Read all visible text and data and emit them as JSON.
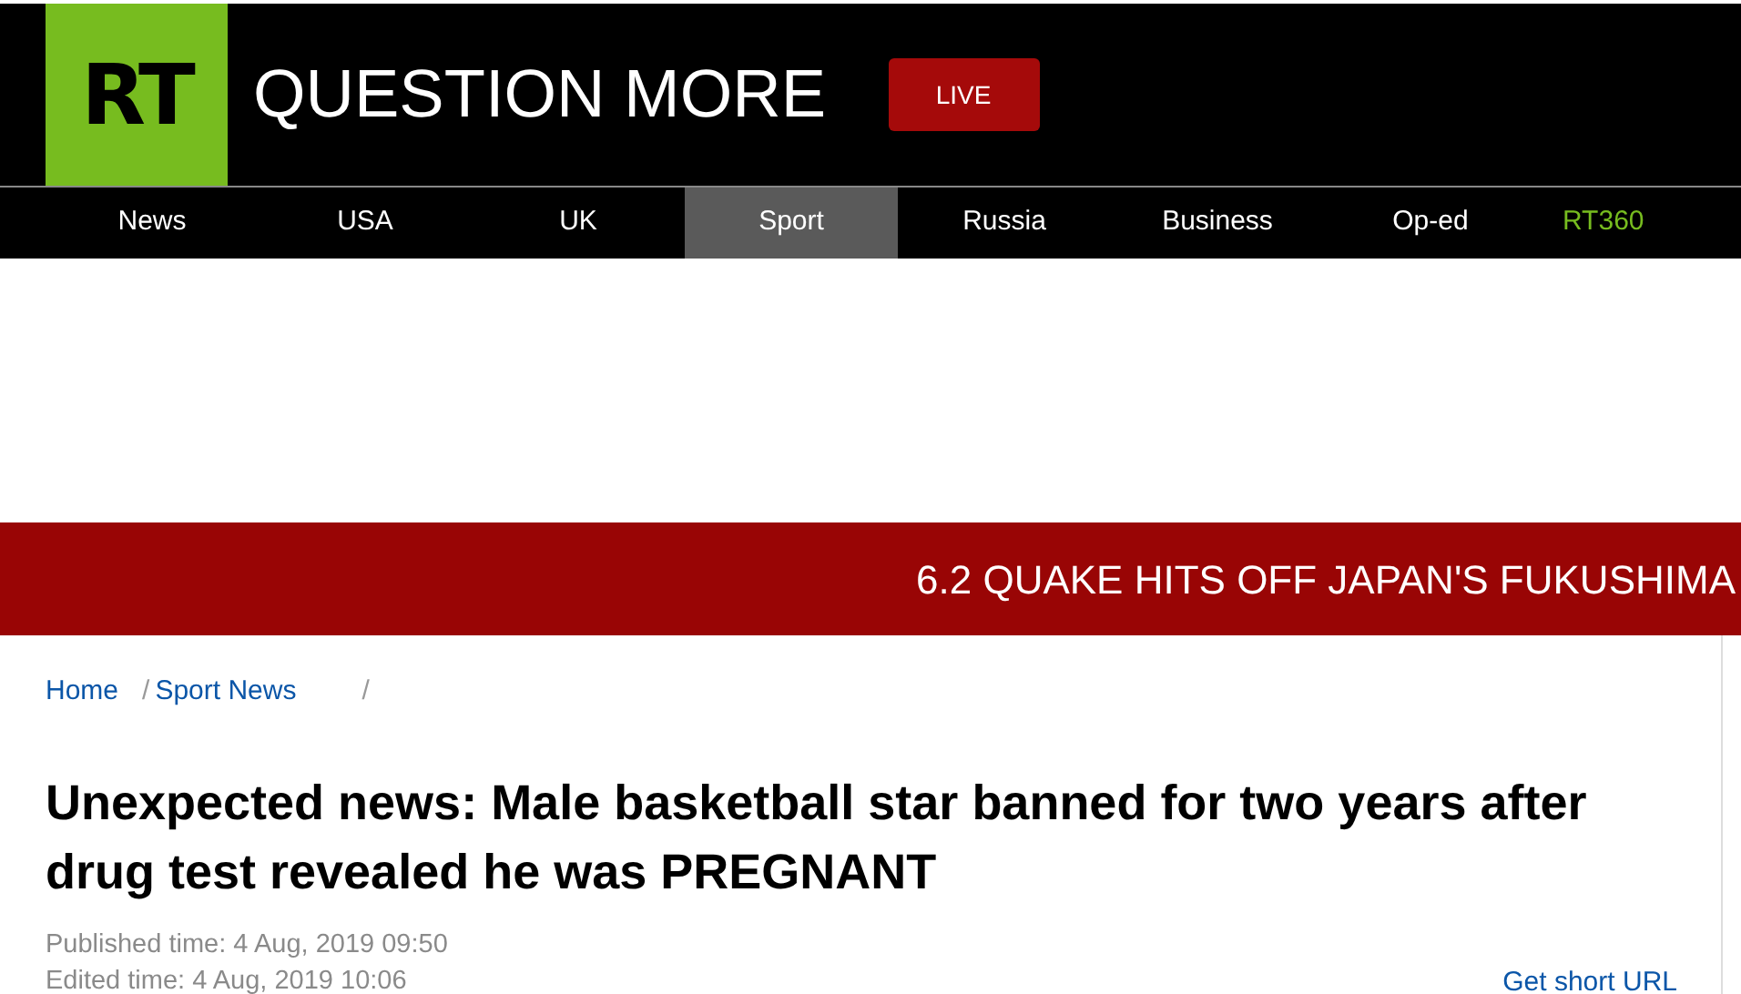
{
  "logo": {
    "text": "RT"
  },
  "tagline": "QUESTION MORE",
  "live_button": "LIVE",
  "nav": [
    {
      "label": "News",
      "selected": false,
      "kind": "section"
    },
    {
      "label": "USA",
      "selected": false,
      "kind": "section"
    },
    {
      "label": "UK",
      "selected": false,
      "kind": "section"
    },
    {
      "label": "Sport",
      "selected": true,
      "kind": "section"
    },
    {
      "label": "Russia",
      "selected": false,
      "kind": "section"
    },
    {
      "label": "Business",
      "selected": false,
      "kind": "section"
    },
    {
      "label": "Op-ed",
      "selected": false,
      "kind": "section"
    },
    {
      "label": "RT360",
      "selected": false,
      "kind": "special"
    }
  ],
  "breaking_news": "6.2 QUAKE HITS OFF JAPAN'S FUKUSHIMA",
  "breadcrumbs": [
    {
      "kind": "link",
      "text": "Home"
    },
    {
      "kind": "separator",
      "text": "/"
    },
    {
      "kind": "link",
      "text": "Sport News"
    },
    {
      "kind": "separator",
      "text": "/"
    }
  ],
  "article": {
    "title": "Unexpected news: Male basketball star banned for two years after drug test revealed he was PREGNANT",
    "published": "Published time: 4 Aug, 2019 09:50",
    "edited": "Edited time: 4 Aug, 2019 10:06",
    "short_url": "Get short URL"
  }
}
